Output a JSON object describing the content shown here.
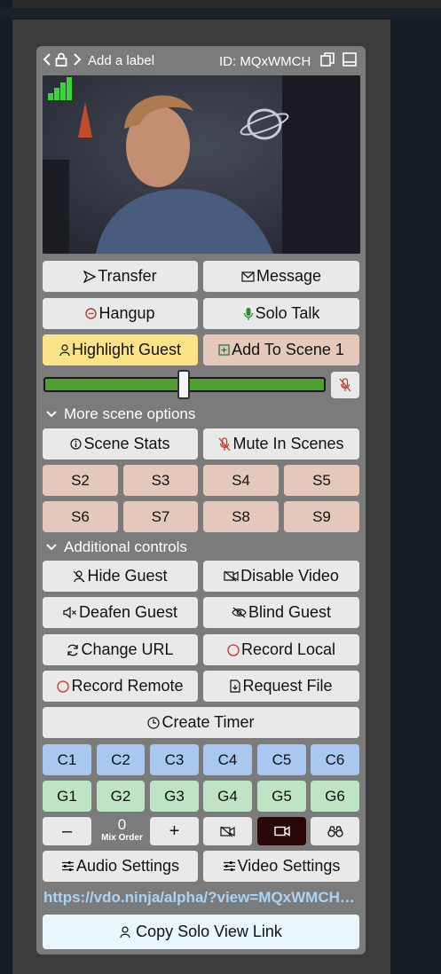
{
  "header": {
    "label": "Add a label",
    "id_text": "ID: MQxWMCH"
  },
  "buttons": {
    "transfer": "Transfer",
    "message": "Message",
    "hangup": "Hangup",
    "solo_talk": "Solo Talk",
    "highlight_guest": "Highlight Guest",
    "add_to_scene": "Add To Scene 1",
    "scene_stats": "Scene Stats",
    "mute_in_scenes": "Mute In Scenes",
    "hide_guest": "Hide Guest",
    "disable_video": "Disable Video",
    "deafen_guest": "Deafen Guest",
    "blind_guest": "Blind Guest",
    "change_url": "Change URL",
    "record_local": "Record Local",
    "record_remote": "Record Remote",
    "request_file": "Request File",
    "create_timer": "Create Timer",
    "audio_settings": "Audio Settings",
    "video_settings": "Video Settings",
    "copy_solo_view_link": "Copy Solo View Link",
    "minus": "–",
    "plus": "+"
  },
  "sections": {
    "more_scene_options": "More scene options",
    "additional_controls": "Additional controls"
  },
  "scenes": [
    "S2",
    "S3",
    "S4",
    "S5",
    "S6",
    "S7",
    "S8",
    "S9"
  ],
  "channels": [
    "C1",
    "C2",
    "C3",
    "C4",
    "C5",
    "C6"
  ],
  "groups": [
    "G1",
    "G2",
    "G3",
    "G4",
    "G5",
    "G6"
  ],
  "mix_order": {
    "value": "0",
    "label": "Mix Order"
  },
  "volume": {
    "level": 0.5
  },
  "solo_link": "https://vdo.ninja/alpha/?view=MQxWMCH&solo",
  "colors": {
    "yellow": "#fce388",
    "rose": "#e4c8bc",
    "blue": "#a9c8f0",
    "green": "#bfe3c5",
    "slider": "#4e9e30",
    "link": "#a9d4f5"
  },
  "icons": {
    "nav_prev": "chevron-left-icon",
    "lock": "lock-icon",
    "nav_next": "chevron-right-icon",
    "copy": "copy-icon",
    "window": "window-icon",
    "signal": "signal-bars-icon",
    "transfer": "send-icon",
    "message": "envelope-icon",
    "hangup": "hangup-icon",
    "solo_talk": "microphone-icon",
    "highlight": "person-icon",
    "add_scene": "plus-square-icon",
    "mute_mic": "muted-mic-icon",
    "stats": "info-icon",
    "hide": "hide-person-icon",
    "disable_video": "camera-off-icon",
    "deafen": "speaker-mute-icon",
    "blind": "eye-slash-icon",
    "change_url": "refresh-icon",
    "record": "record-circle-icon",
    "file": "file-icon",
    "timer": "clock-icon",
    "sliders": "sliders-icon",
    "camera": "video-camera-icon",
    "binoculars": "binoculars-icon"
  }
}
